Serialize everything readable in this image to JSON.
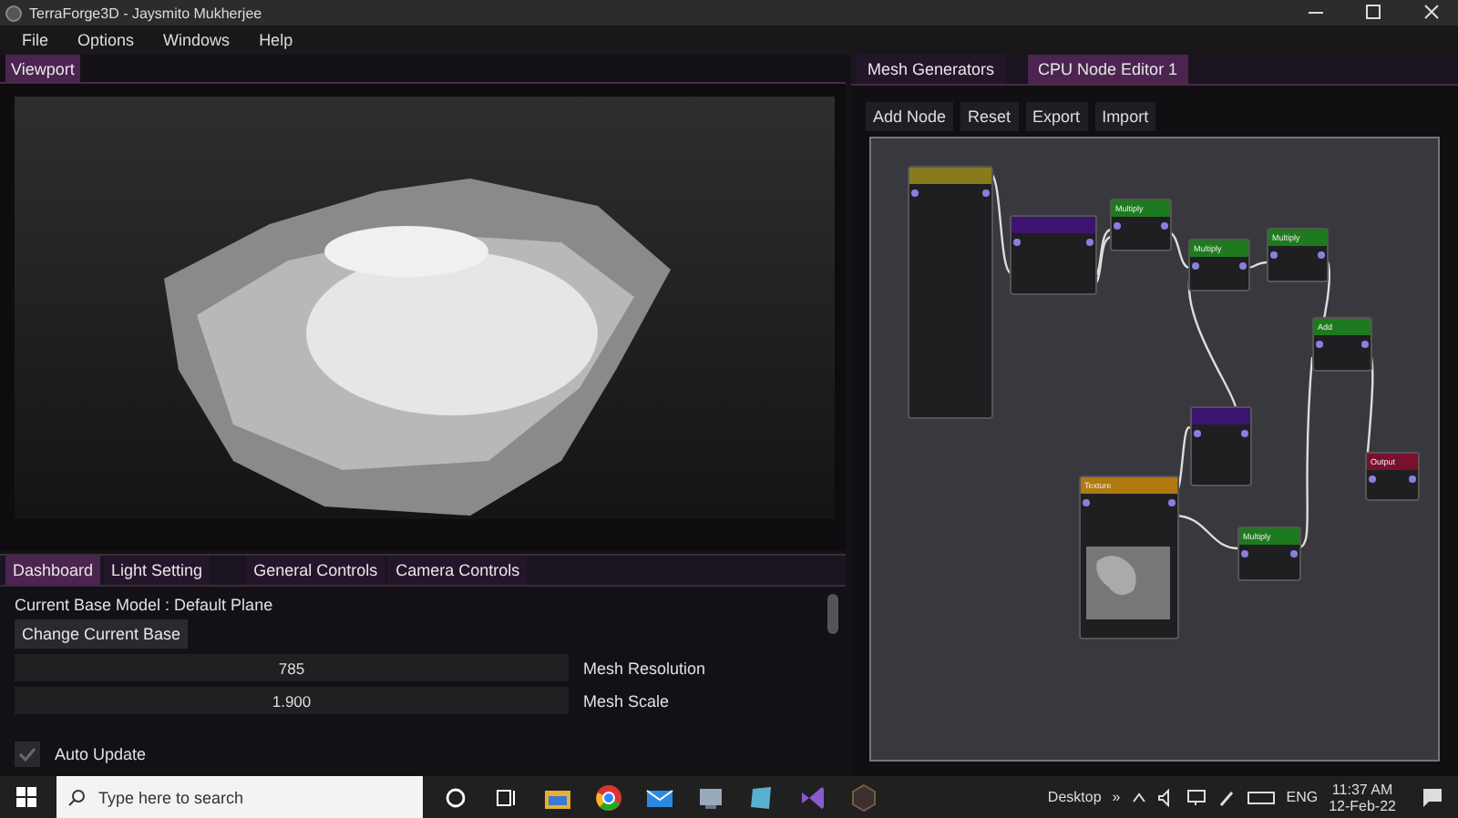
{
  "window": {
    "title": "TerraForge3D - Jaysmito Mukherjee"
  },
  "menu": [
    "File",
    "Options",
    "Windows",
    "Help"
  ],
  "viewport": {
    "tabs": [
      {
        "label": "Viewport",
        "selected": true
      }
    ]
  },
  "dashboard": {
    "tabs": [
      {
        "label": "Dashboard",
        "selected": true
      },
      {
        "label": "Light Setting",
        "selected": false
      },
      {
        "label": "General Controls",
        "selected": false
      },
      {
        "label": "Camera Controls",
        "selected": false
      }
    ],
    "base_model": "Current Base Model : Default Plane",
    "change_button": "Change Current Base",
    "fields": [
      {
        "value": "785",
        "label": "Mesh Resolution"
      },
      {
        "value": "1.900",
        "label": "Mesh Scale"
      }
    ],
    "auto_update": {
      "label": "Auto Update",
      "checked": true
    }
  },
  "node_editor": {
    "tabs": [
      {
        "label": "Mesh Generators",
        "selected": false
      },
      {
        "label": "CPU Node Editor 1",
        "selected": true
      }
    ],
    "toolbar": [
      "Add Node",
      "Reset",
      "Export",
      "Import"
    ],
    "nodes": [
      {
        "color": "#8a7a1e"
      },
      {
        "color": "#3c1470"
      },
      {
        "title": "Multiply",
        "color": "#1e7a1e"
      },
      {
        "title": "Multiply",
        "color": "#1e7a1e"
      },
      {
        "title": "Multiply",
        "color": "#1e7a1e"
      },
      {
        "title": "Add",
        "color": "#1e7a1e"
      },
      {
        "color": "#3c1470"
      },
      {
        "title": "Texture",
        "color": "#b07a10"
      },
      {
        "title": "Multiply",
        "color": "#1e7a1e"
      },
      {
        "title": "Output",
        "color": "#7a1030"
      }
    ]
  },
  "taskbar": {
    "search": {
      "placeholder": "Type here to search"
    },
    "tray_label": "Desktop",
    "chevron": "»",
    "language": "ENG",
    "time": "11:37 AM",
    "date": "12-Feb-22"
  }
}
